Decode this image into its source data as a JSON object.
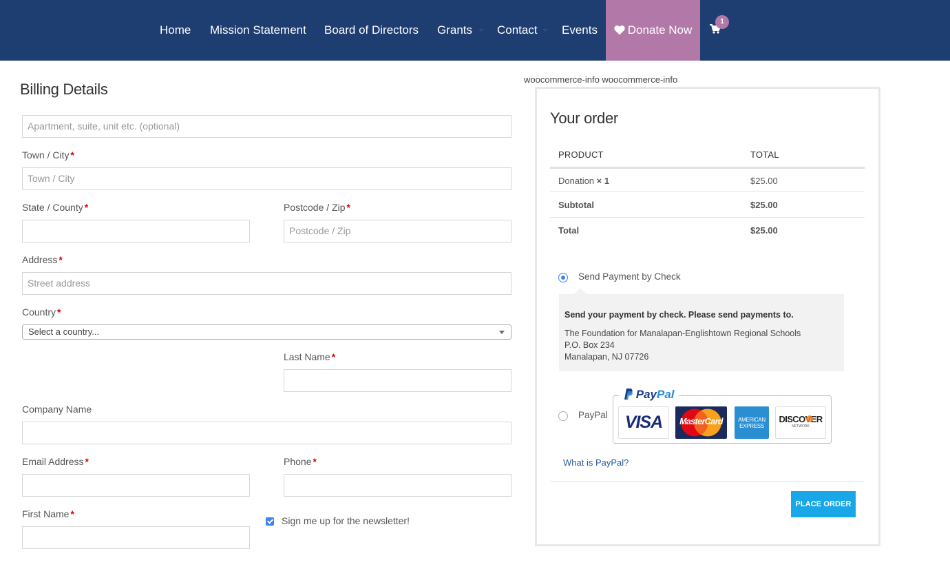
{
  "nav": {
    "items": [
      {
        "label": "Home"
      },
      {
        "label": "Mission Statement"
      },
      {
        "label": "Board of Directors"
      },
      {
        "label": "Grants"
      },
      {
        "label": "Contact"
      },
      {
        "label": "Events"
      }
    ],
    "donate_label": "Donate Now",
    "cart_count": "1",
    "colors": {
      "bar": "#1e3d70",
      "donate": "#b178a8"
    }
  },
  "billing": {
    "title": "Billing Details",
    "apartment_placeholder": "Apartment, suite, unit etc. (optional)",
    "town_label": "Town / City",
    "town_placeholder": "Town / City",
    "state_label": "State / County",
    "postcode_label": "Postcode / Zip",
    "postcode_placeholder": "Postcode / Zip",
    "address_label": "Address",
    "address_placeholder": "Street address",
    "country_label": "Country",
    "country_selected": "Select a country...",
    "last_name_label": "Last Name",
    "company_label": "Company Name",
    "email_label": "Email Address",
    "phone_label": "Phone",
    "first_name_label": "First Name",
    "newsletter_label": "Sign me up for the newsletter!",
    "required_mark": "*"
  },
  "order": {
    "info_text": "woocommerce-info woocommerce-info",
    "title": "Your order",
    "col_product": "PRODUCT",
    "col_total": "TOTAL",
    "item_name": "Donation",
    "item_qty": "× 1",
    "item_total": "$25.00",
    "subtotal_label": "Subtotal",
    "subtotal_value": "$25.00",
    "total_label": "Total",
    "total_value": "$25.00"
  },
  "payment": {
    "check_label": "Send Payment by Check",
    "check_heading": "Send your payment by check. Please send payments to.",
    "check_line1": "The Foundation for Manalapan-Englishtown Regional Schools",
    "check_line2": "P.O. Box 234",
    "check_line3": "Manalapan, NJ 07726",
    "paypal_label": "PayPal",
    "paypal_logo_a": "Pay",
    "paypal_logo_b": "Pal",
    "cards": {
      "visa": "VISA",
      "mastercard": "MasterCard",
      "amex_a": "AMERICAN",
      "amex_b": "EXPRESS",
      "discover": "DISCOVER",
      "discover_sub": "NETWORK"
    },
    "what_is_paypal": "What is PayPal?",
    "place_order": "PLACE ORDER",
    "accent": "#1aa7e8"
  }
}
